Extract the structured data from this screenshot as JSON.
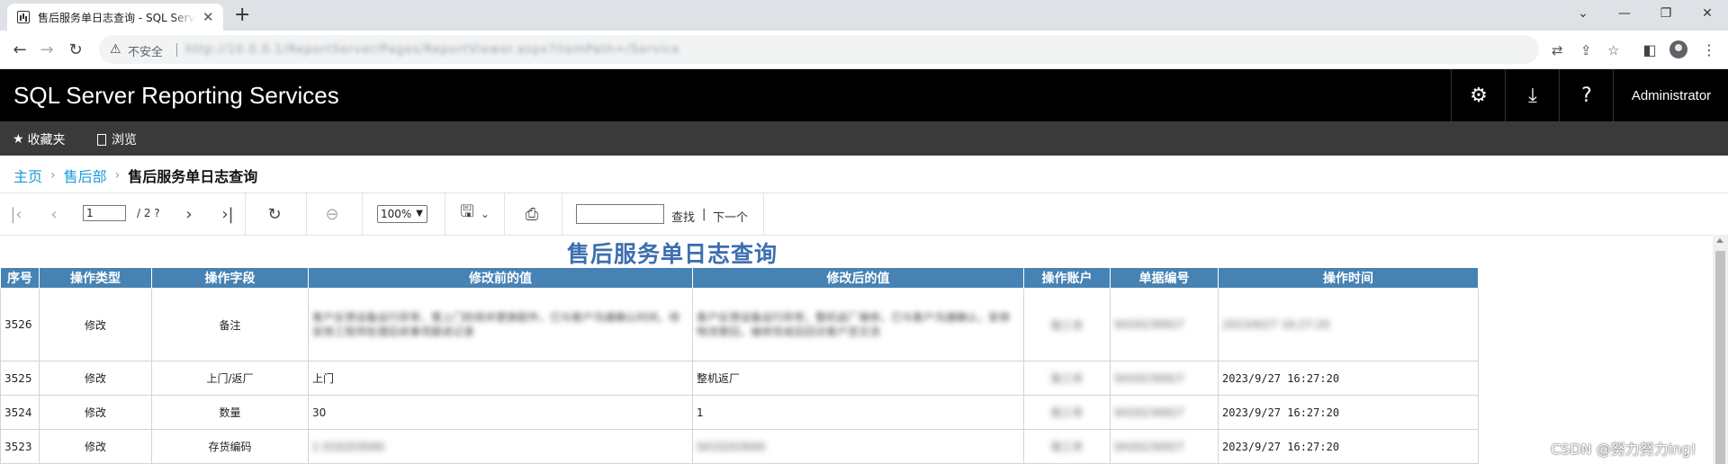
{
  "browser": {
    "tab_title": "售后服务单日志查询 - SQL Server Reporting Services",
    "tab_close": "✕",
    "new_tab": "+",
    "security_label": "不安全",
    "url": "http://10.0.0.1/ReportServer/Pages/ReportViewer.aspx?itemPath=/Service"
  },
  "header": {
    "brand": "SQL Server Reporting Services",
    "user": "Administrator",
    "icons": [
      "gear-icon",
      "download-icon",
      "help-icon"
    ]
  },
  "subnav": {
    "favorites": "收藏夹",
    "browse": "浏览"
  },
  "breadcrumb": {
    "home": "主页",
    "folder": "售后部",
    "current": "售后服务单日志查询"
  },
  "toolbar": {
    "page_current": "1",
    "page_total": "/ 2 ?",
    "zoom": "100%",
    "find": "查找",
    "find_sep": "|",
    "find_next": "下一个"
  },
  "report": {
    "title": "售后服务单日志查询",
    "columns": [
      "序号",
      "操作类型",
      "操作字段",
      "修改前的值",
      "修改后的值",
      "操作账户",
      "单据编号",
      "操作时间"
    ],
    "rows": [
      {
        "id": "3526",
        "type": "修改",
        "field": "备注",
        "before": "客户反馈设备运行异常，需上门检修并更换配件，已与客户沟通确认时间，待安排工程师处理后续事项跟进记录",
        "after": "客户反馈设备运行异常，整机返厂维修，已与客户沟通确认，安排物流寄回，维修完成后回访客户至交流",
        "account": "张三丰",
        "doc_no": "SH20230927",
        "time": "2023/9/27 16:27:20"
      },
      {
        "id": "3525",
        "type": "修改",
        "field": "上门/返厂",
        "before": "上门",
        "after": "整机返厂",
        "account": "张三丰",
        "doc_no": "SH20230927",
        "time": "2023/9/27 16:27:20"
      },
      {
        "id": "3524",
        "type": "修改",
        "field": "数量",
        "before": "30",
        "after": "1",
        "account": "张三丰",
        "doc_no": "SH20230927",
        "time": "2023/9/27 16:27:20"
      },
      {
        "id": "3523",
        "type": "修改",
        "field": "存货编码",
        "before": "1 010203040",
        "after": "S010203040",
        "account": "张三丰",
        "doc_no": "SH20230927",
        "time": "2023/9/27 16:27:20"
      }
    ]
  },
  "watermark": "CSDN @努力努力ing!"
}
